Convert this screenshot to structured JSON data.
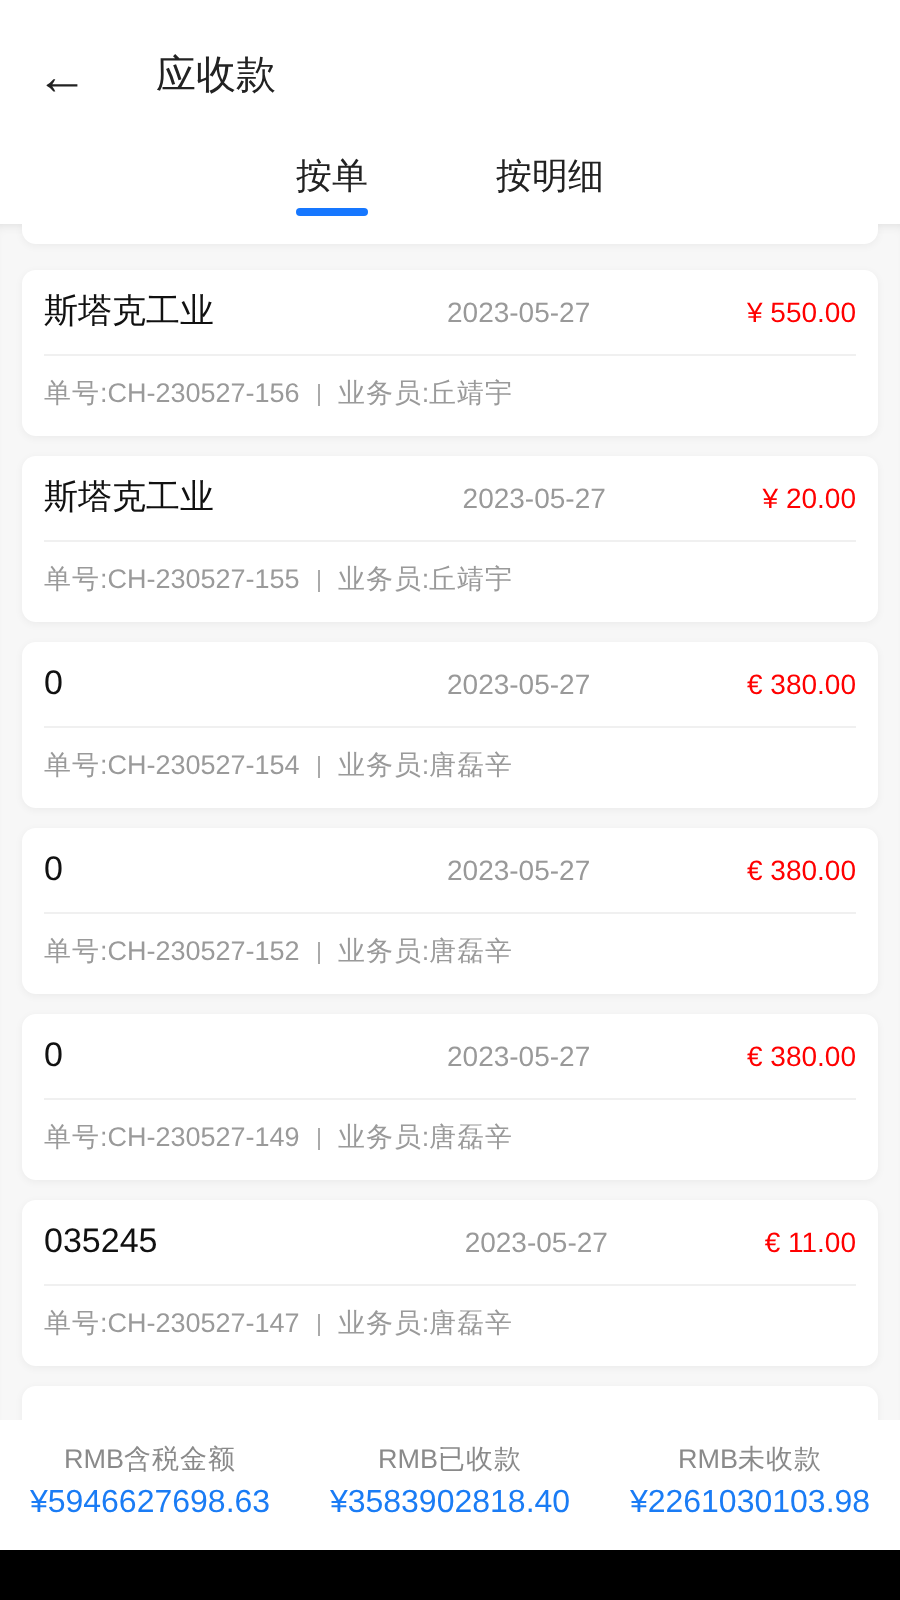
{
  "header": {
    "back": "←",
    "title": "应收款"
  },
  "tabs": [
    {
      "label": "按单",
      "selected": true
    },
    {
      "label": "按明细",
      "selected": false
    }
  ],
  "orders": [
    {
      "customer": "斯塔克工业",
      "date": "2023-05-27",
      "amount": "¥ 550.00",
      "number": "单号:CH-230527-156",
      "salesperson": "业务员:丘靖宇"
    },
    {
      "customer": "斯塔克工业",
      "date": "2023-05-27",
      "amount": "¥ 20.00",
      "number": "单号:CH-230527-155",
      "salesperson": "业务员:丘靖宇"
    },
    {
      "customer": "0",
      "date": "2023-05-27",
      "amount": "€ 380.00",
      "number": "单号:CH-230527-154",
      "salesperson": "业务员:唐磊辛"
    },
    {
      "customer": "0",
      "date": "2023-05-27",
      "amount": "€ 380.00",
      "number": "单号:CH-230527-152",
      "salesperson": "业务员:唐磊辛"
    },
    {
      "customer": "0",
      "date": "2023-05-27",
      "amount": "€ 380.00",
      "number": "单号:CH-230527-149",
      "salesperson": "业务员:唐磊辛"
    },
    {
      "customer": "035245",
      "date": "2023-05-27",
      "amount": "€ 11.00",
      "number": "单号:CH-230527-147",
      "salesperson": "业务员:唐磊辛"
    }
  ],
  "summary": [
    {
      "label": "RMB含税金额",
      "value": "¥5946627698.63"
    },
    {
      "label": "RMB已收款",
      "value": "¥3583902818.40"
    },
    {
      "label": "RMB未收款",
      "value": "¥2261030103.98"
    }
  ]
}
